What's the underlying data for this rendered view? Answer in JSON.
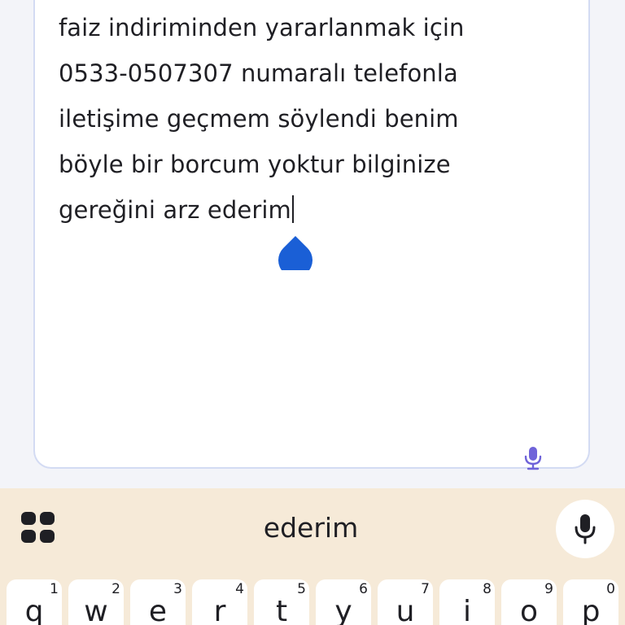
{
  "editor": {
    "lines": [
      "faiz indiriminden yararlanmak için",
      "0533-0507307 numaralı telefonla",
      "iletişime geçmem söylendi benim",
      "böyle bir borcum yoktur bilginize",
      "gereğini arz ederim"
    ],
    "cursor_handle_color": "#1a5fd6",
    "mic_icon": "microphone-icon",
    "mic_icon_color": "#6f63d9"
  },
  "keyboard": {
    "background_color": "#f6ead8",
    "apps_icon": "grid-apps-icon",
    "suggestion": "ederim",
    "voice_icon": "microphone-icon",
    "top_row": [
      {
        "letter": "q",
        "digit": "1"
      },
      {
        "letter": "w",
        "digit": "2"
      },
      {
        "letter": "e",
        "digit": "3"
      },
      {
        "letter": "r",
        "digit": "4"
      },
      {
        "letter": "t",
        "digit": "5"
      },
      {
        "letter": "y",
        "digit": "6"
      },
      {
        "letter": "u",
        "digit": "7"
      },
      {
        "letter": "i",
        "digit": "8"
      },
      {
        "letter": "o",
        "digit": "9"
      },
      {
        "letter": "p",
        "digit": "0"
      }
    ]
  }
}
